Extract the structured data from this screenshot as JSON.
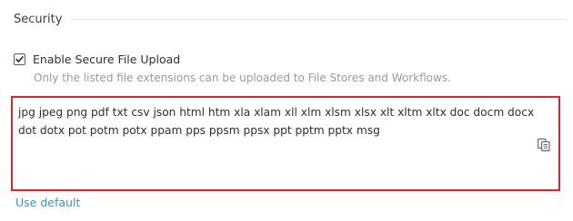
{
  "section": {
    "title": "Security"
  },
  "secure_upload": {
    "label": "Enable Secure File Upload",
    "checked": true,
    "help": "Only the listed file extensions can be uploaded to File Stores and Workflows."
  },
  "extensions": {
    "value": "jpg jpeg png pdf txt csv json html htm xla xlam xll xlm xlsm xlsx xlt xltm xltx doc docm docx dot dotx pot potm potx ppam pps ppsm ppsx ppt pptm pptx msg",
    "copy_icon": "copy-icon",
    "highlight_color": "#d6262f"
  },
  "actions": {
    "use_default_label": "Use default"
  },
  "colors": {
    "link": "#3a8fd6",
    "help_text": "#9a9a9a"
  }
}
